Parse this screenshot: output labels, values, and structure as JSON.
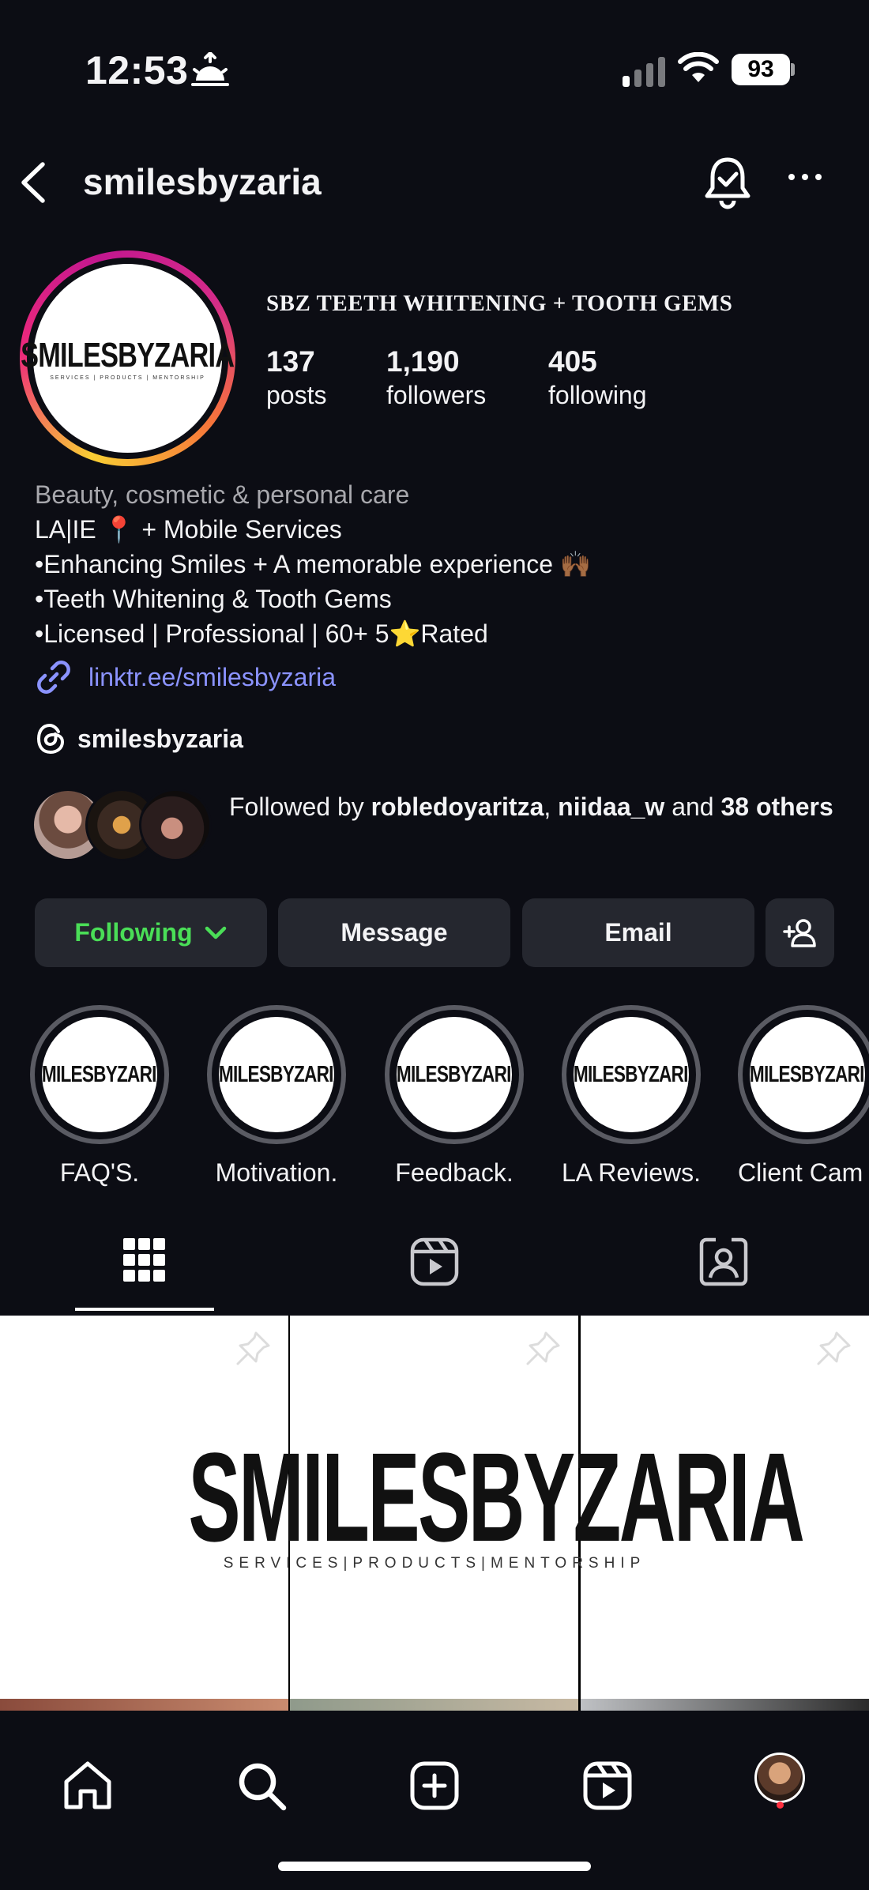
{
  "status_bar": {
    "time": "12:53",
    "battery": "93"
  },
  "header": {
    "username": "smilesbyzaria"
  },
  "profile": {
    "avatar_logo": "SMILESBYZARIA",
    "avatar_logo_sub": "SERVICES | PRODUCTS | MENTORSHIP",
    "business_name": "SBZ TEETH WHITENING + TOOTH GEMS",
    "stats": [
      {
        "value": "137",
        "label": "posts"
      },
      {
        "value": "1,190",
        "label": "followers"
      },
      {
        "value": "405",
        "label": "following"
      }
    ],
    "bio": {
      "category": "Beauty, cosmetic & personal care",
      "lines": [
        "LA|IE 📍 + Mobile Services",
        "•Enhancing Smiles + A memorable experience 🙌🏾",
        "•Teeth Whitening & Tooth Gems",
        "•Licensed | Professional | 60+ 5⭐Rated"
      ]
    },
    "link": "linktr.ee/smilesbyzaria",
    "threads_handle": "smilesbyzaria",
    "followed_by": {
      "prefix": "Followed by ",
      "user1": "robledoyaritza",
      "separator": ", ",
      "user2": "niidaa_w",
      "and": " and ",
      "others": "38 others"
    }
  },
  "buttons": {
    "following": "Following",
    "message": "Message",
    "email": "Email"
  },
  "highlights": [
    {
      "label": "FAQ'S."
    },
    {
      "label": "Motivation."
    },
    {
      "label": "Feedback."
    },
    {
      "label": "LA Reviews."
    },
    {
      "label": "Client Cam"
    }
  ],
  "highlight_logo": "SMILESBYZARIA",
  "post": {
    "logo": "SMILESBYZARIA",
    "sub": "SERVICES|PRODUCTS|MENTORSHIP"
  },
  "colors": {
    "accent_following": "#4ade57",
    "link": "#8b93ff",
    "notification_dot": "#ff3040"
  },
  "icons": [
    "back-icon",
    "bell-check-icon",
    "more-icon",
    "link-icon",
    "threads-icon",
    "add-person-icon",
    "grid-icon",
    "reels-icon",
    "tagged-icon",
    "pin-icon",
    "home-icon",
    "search-icon",
    "create-icon",
    "reels-nav-icon"
  ]
}
